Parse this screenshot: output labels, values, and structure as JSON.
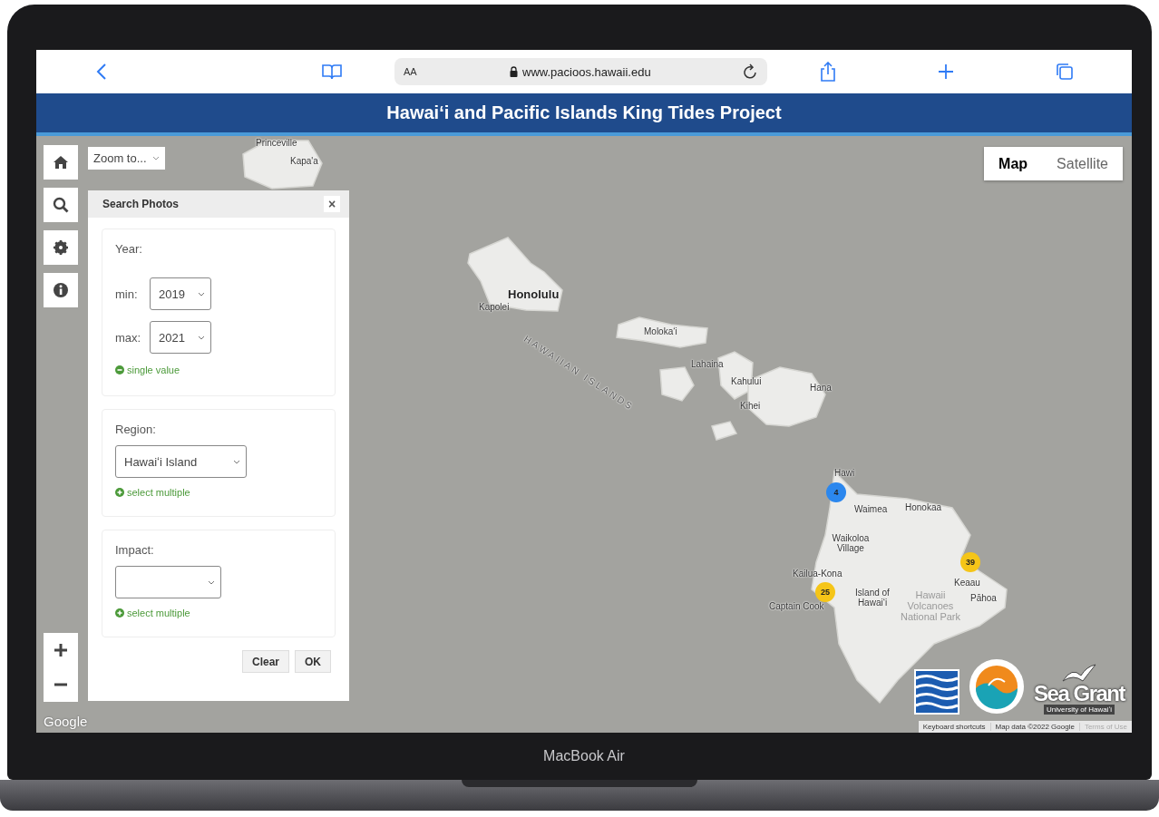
{
  "browser": {
    "text_size": "AA",
    "url": "www.pacioos.hawaii.edu"
  },
  "header": {
    "title": "Hawaiʻi and Pacific Islands King Tides Project"
  },
  "map": {
    "zoom_to": "Zoom to...",
    "map_types": [
      {
        "label": "Map",
        "selected": true
      },
      {
        "label": "Satellite",
        "selected": false
      }
    ],
    "places": [
      {
        "name": "Princeville",
        "kind": "town"
      },
      {
        "name": "Kapa'a",
        "kind": "town"
      },
      {
        "name": "Honolulu",
        "kind": "city"
      },
      {
        "name": "Kapolei",
        "kind": "town"
      },
      {
        "name": "HAWAIIAN ISLANDS",
        "kind": "region"
      },
      {
        "name": "Molokaʻi",
        "kind": "town"
      },
      {
        "name": "Lahaina",
        "kind": "town"
      },
      {
        "name": "Kahului",
        "kind": "town"
      },
      {
        "name": "Kihei",
        "kind": "town"
      },
      {
        "name": "Hana",
        "kind": "town"
      },
      {
        "name": "Hawi",
        "kind": "town"
      },
      {
        "name": "Waimea",
        "kind": "town"
      },
      {
        "name": "Honokaa",
        "kind": "town"
      },
      {
        "name": "Waikoloa Village",
        "kind": "town"
      },
      {
        "name": "Kailua-Kona",
        "kind": "town"
      },
      {
        "name": "Island of Hawaiʻi",
        "kind": "town"
      },
      {
        "name": "Keaau",
        "kind": "town"
      },
      {
        "name": "Pāhoa",
        "kind": "town"
      },
      {
        "name": "Captain Cook",
        "kind": "town"
      },
      {
        "name": "Hawaii Volcanoes National Park",
        "kind": "park"
      }
    ],
    "clusters": [
      {
        "count": "4",
        "color": "#2b87ee"
      },
      {
        "count": "39",
        "color": "#f5c518"
      },
      {
        "count": "25",
        "color": "#f5c518"
      }
    ],
    "sea_grant": {
      "name": "Sea Grant",
      "subtitle": "University of Hawaiʻi"
    },
    "provider": "Google",
    "attribution": [
      "Keyboard shortcuts",
      "Map data ©2022 Google",
      "Terms of Use"
    ]
  },
  "search_panel": {
    "title": "Search Photos",
    "close": "×",
    "sections": [
      {
        "kind": "range",
        "label": "Year:",
        "min_label": "min:",
        "min": "2019",
        "max_label": "max:",
        "max": "2021",
        "toggle": "single value"
      },
      {
        "kind": "select",
        "label": "Region:",
        "value": "Hawaiʻi Island",
        "toggle": "select multiple"
      },
      {
        "kind": "select",
        "label": "Impact:",
        "toggle": "select multiple"
      }
    ],
    "buttons": [
      "Clear",
      "OK"
    ]
  },
  "device_label": "MacBook Air"
}
